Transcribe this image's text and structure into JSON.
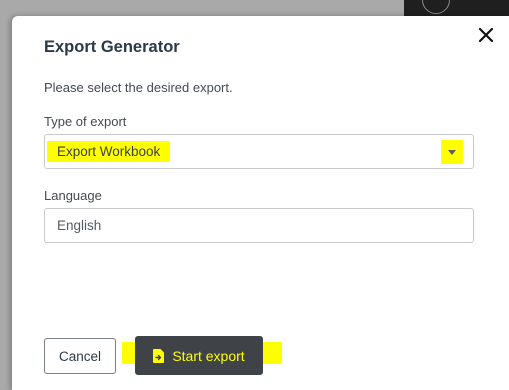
{
  "dialog": {
    "title": "Export Generator",
    "intro": "Please select the desired export.",
    "close_icon": "close-icon"
  },
  "export_type": {
    "label": "Type of export",
    "value": "Export Workbook",
    "arrow_icon": "caret-down-icon"
  },
  "language": {
    "label": "Language",
    "value": "English"
  },
  "actions": {
    "cancel_label": "Cancel",
    "start_label": "Start export",
    "start_icon": "file-export-icon"
  },
  "colors": {
    "highlight": "#ffff00",
    "primary_button": "#3f4247",
    "title_text": "#2b3a4a"
  }
}
